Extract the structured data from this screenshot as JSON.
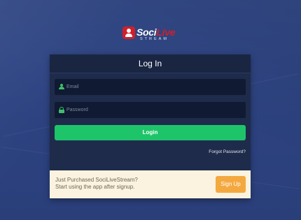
{
  "brand": {
    "word_part1": "Soci",
    "word_part2": "Live",
    "subtitle": "STREAM"
  },
  "login_form": {
    "title": "Log In",
    "email_placeholder": "Email",
    "password_placeholder": "Password",
    "login_label": "Login",
    "forgot_label": "Forgot Password?"
  },
  "promo": {
    "line1": "Just Purchased SociLiveStream?",
    "line2": "Start using the app after signup.",
    "signup_label": "Sign Up"
  },
  "colors": {
    "background": "#2f4582",
    "card": "#1e2b4b",
    "login_button": "#1ec46a",
    "signup_button": "#f4a940",
    "promo_background": "#fbf3df",
    "brand_red": "#d01f2a"
  },
  "icons": {
    "email_field": "person-icon",
    "password_field": "lock-icon"
  }
}
